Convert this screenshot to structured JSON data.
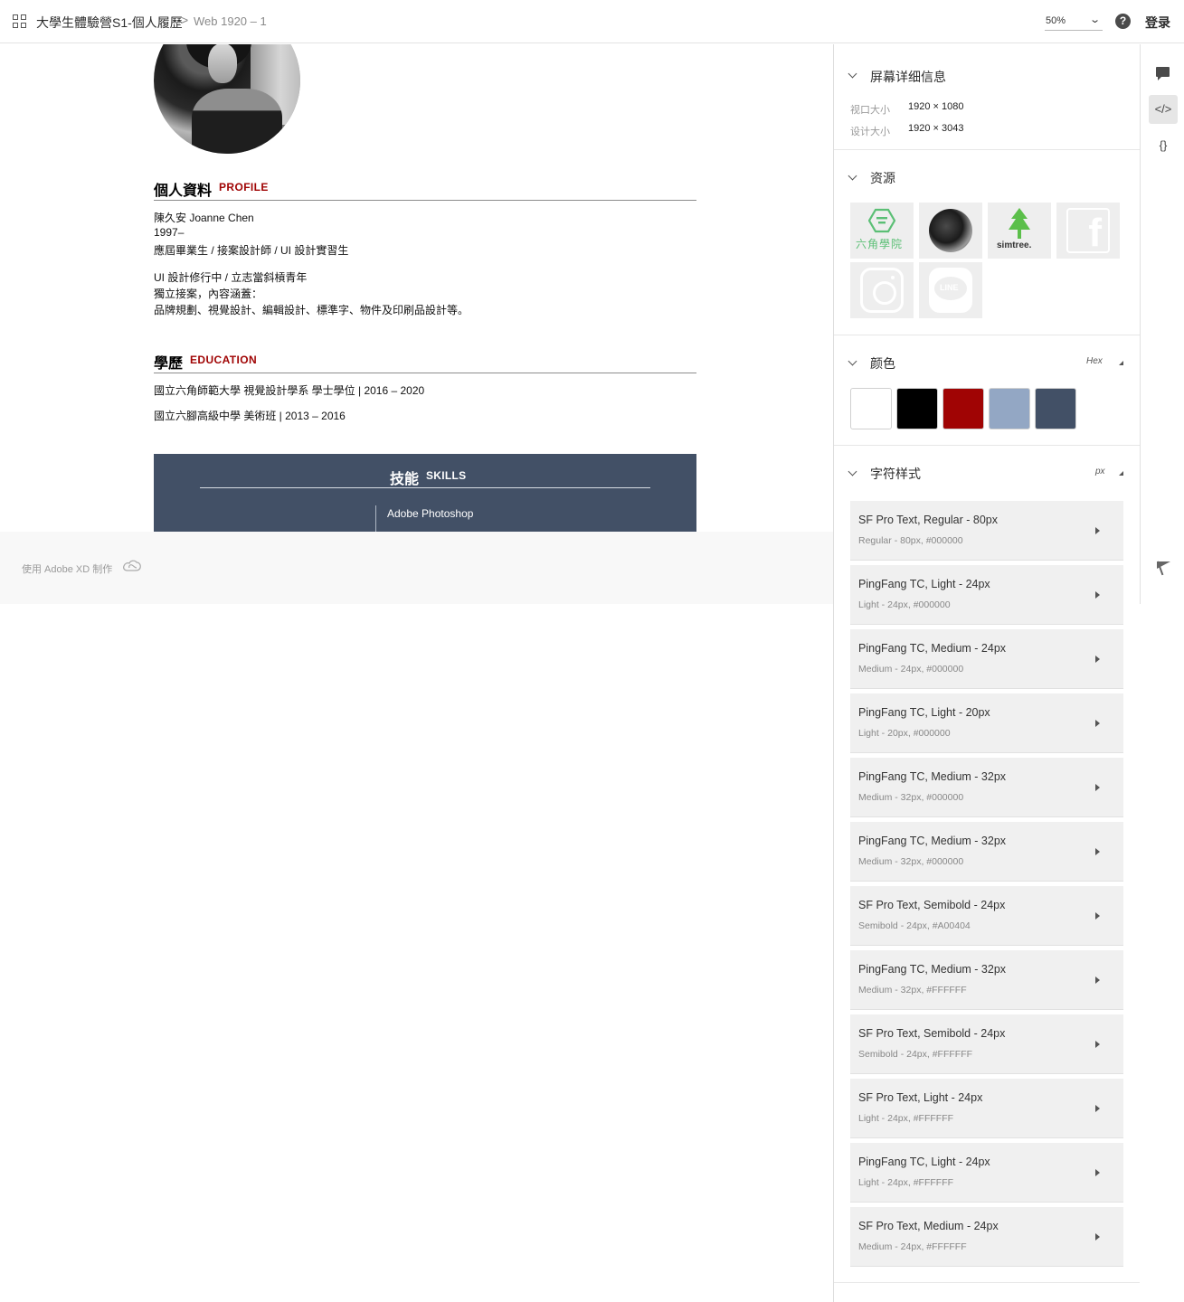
{
  "topbar": {
    "project": "大學生體驗營S1-個人履歷",
    "separator": ">",
    "page": "Web 1920 – 1",
    "zoom": "50%",
    "help": "?",
    "login": "登录"
  },
  "artboard": {
    "profile": {
      "heading_zh": "個人資料",
      "heading_en": "PROFILE",
      "lines": [
        "陳久安 Joanne Chen",
        "1997–",
        "應屆畢業生 / 接案設計師 / UI 設計實習生",
        "UI 設計修行中 / 立志當斜槓青年",
        "獨立接案，內容涵蓋：",
        "品牌規劃、視覺設計、編輯設計、標準字、物件及印刷品設計等。"
      ]
    },
    "education": {
      "heading_zh": "學歷",
      "heading_en": "EDUCATION",
      "lines": [
        "國立六角師範大學 視覺設計學系 學士學位 | 2016 – 2020",
        "國立六腳高級中學 美術班 | 2013 – 2016"
      ]
    },
    "skills": {
      "heading_zh": "技能",
      "heading_en": "SKILLS",
      "items": [
        "Adobe Photoshop"
      ]
    },
    "footer": "使用 Adobe XD 制作"
  },
  "panel": {
    "screen_info": {
      "title": "屏幕详细信息",
      "viewport_label": "视口大小",
      "viewport_value": "1920 × 1080",
      "design_label": "设计大小",
      "design_value": "1920 × 3043"
    },
    "assets": {
      "title": "资源",
      "hex_label": "六角學院",
      "simtree_label": "simtree.",
      "line_label": "LINE",
      "fb_label": "f"
    },
    "colors": {
      "title": "颜色",
      "unit": "Hex",
      "swatches": [
        "#FFFFFF",
        "#000000",
        "#A00404",
        "#93A7C4",
        "#425066"
      ]
    },
    "char_styles": {
      "title": "字符样式",
      "unit": "px",
      "items": [
        {
          "name": "SF Pro Text, Regular - 80px",
          "meta": "Regular - 80px, #000000"
        },
        {
          "name": "PingFang TC, Light - 24px",
          "meta": "Light - 24px, #000000"
        },
        {
          "name": "PingFang TC, Medium - 24px",
          "meta": "Medium - 24px, #000000"
        },
        {
          "name": "PingFang TC, Light - 20px",
          "meta": "Light - 20px, #000000"
        },
        {
          "name": "PingFang TC, Medium - 32px",
          "meta": "Medium - 32px, #000000"
        },
        {
          "name": "PingFang TC, Medium - 32px",
          "meta": "Medium - 32px, #000000"
        },
        {
          "name": "SF Pro Text, Semibold - 24px",
          "meta": "Semibold - 24px, #A00404"
        },
        {
          "name": "PingFang TC, Medium - 32px",
          "meta": "Medium - 32px, #FFFFFF"
        },
        {
          "name": "SF Pro Text, Semibold - 24px",
          "meta": "Semibold - 24px, #FFFFFF"
        },
        {
          "name": "SF Pro Text, Light - 24px",
          "meta": "Light - 24px, #FFFFFF"
        },
        {
          "name": "PingFang TC, Light - 24px",
          "meta": "Light - 24px, #FFFFFF"
        },
        {
          "name": "SF Pro Text, Medium - 24px",
          "meta": "Medium - 24px, #FFFFFF"
        }
      ]
    }
  },
  "rail": {
    "code_glyph": "</>",
    "css_glyph": "{}"
  }
}
